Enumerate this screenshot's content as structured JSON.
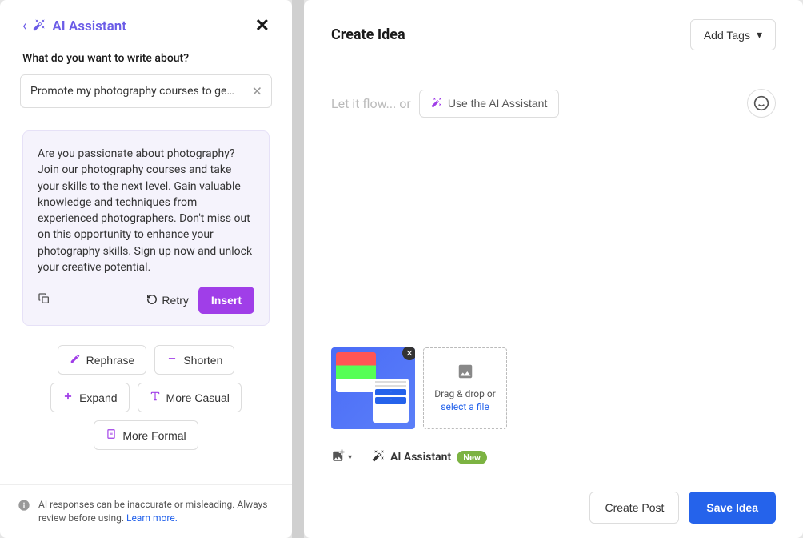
{
  "left": {
    "title": "AI Assistant",
    "prompt_label": "What do you want to write about?",
    "prompt_value": "Promote my photography courses to ge…",
    "result_text": "Are you passionate about photography? Join our photography courses and take your skills to the next level. Gain valuable knowledge and techniques from experienced photographers. Don't miss out on this opportunity to enhance your photography skills. Sign up now and unlock your creative potential.",
    "retry": "Retry",
    "insert": "Insert",
    "options": {
      "rephrase": "Rephrase",
      "shorten": "Shorten",
      "expand": "Expand",
      "more_casual": "More Casual",
      "more_formal": "More Formal"
    },
    "notice_text": "AI responses can be inaccurate or misleading. Always review before using. ",
    "notice_link": "Learn more."
  },
  "right": {
    "title": "Create Idea",
    "add_tags": "Add Tags",
    "placeholder": "Let it flow... or",
    "use_ai": "Use the AI Assistant",
    "dropzone_prefix": "Drag & drop or ",
    "dropzone_link": "select a file",
    "ai_assistant": "AI Assistant",
    "new_badge": "New",
    "create_post": "Create Post",
    "save_idea": "Save Idea"
  }
}
